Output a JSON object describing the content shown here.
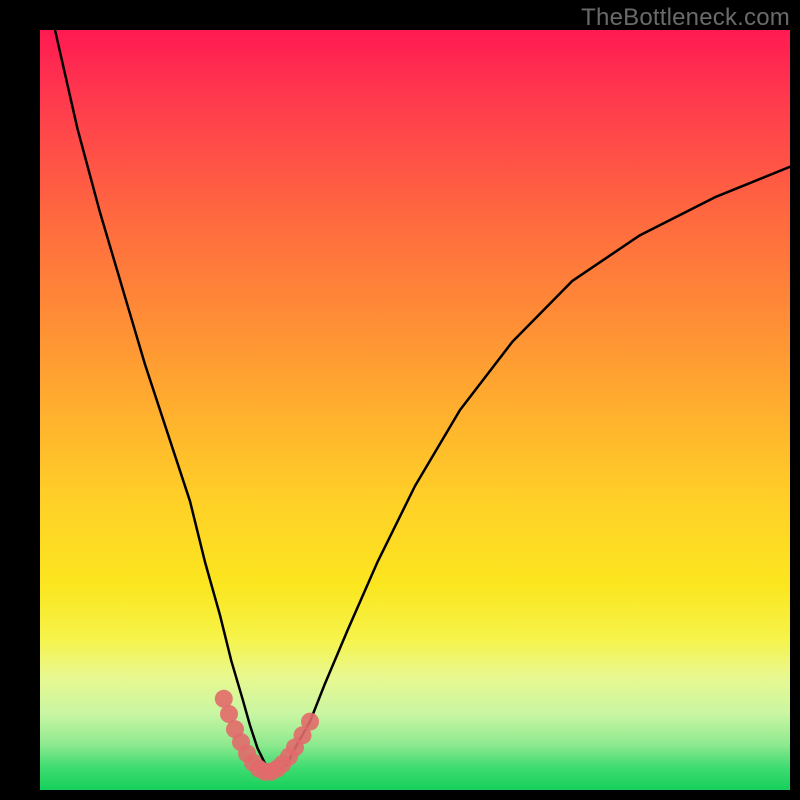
{
  "watermark": "TheBottleneck.com",
  "chart_data": {
    "type": "line",
    "title": "",
    "xlabel": "",
    "ylabel": "",
    "xlim": [
      0,
      100
    ],
    "ylim": [
      0,
      100
    ],
    "series": [
      {
        "name": "bottleneck-curve",
        "x": [
          2,
          5,
          8,
          11,
          14,
          17,
          20,
          22,
          24,
          25.5,
          27,
          28,
          29,
          30,
          31,
          32,
          33,
          34,
          36,
          38,
          41,
          45,
          50,
          56,
          63,
          71,
          80,
          90,
          100
        ],
        "y": [
          100,
          87,
          76,
          66,
          56,
          47,
          38,
          30,
          23,
          17,
          12,
          8.5,
          5.5,
          3.5,
          2.5,
          2.5,
          3.5,
          5.5,
          9,
          14,
          21,
          30,
          40,
          50,
          59,
          67,
          73,
          78,
          82
        ]
      },
      {
        "name": "highlight-band",
        "x": [
          24.5,
          25.2,
          26.0,
          26.8,
          27.6,
          28.4,
          29.2,
          30.0,
          30.8,
          31.6,
          32.3,
          33.2,
          34.0,
          35.0,
          36.0
        ],
        "y": [
          12.0,
          10.0,
          8.0,
          6.3,
          4.8,
          3.6,
          2.8,
          2.4,
          2.4,
          2.8,
          3.4,
          4.4,
          5.6,
          7.2,
          9.0
        ]
      }
    ],
    "gradient_stops": [
      {
        "pos": 0.0,
        "color": "#ff1a52"
      },
      {
        "pos": 0.25,
        "color": "#ff6a3f"
      },
      {
        "pos": 0.5,
        "color": "#ffaf2e"
      },
      {
        "pos": 0.73,
        "color": "#fbe61f"
      },
      {
        "pos": 0.9,
        "color": "#c9f6a3"
      },
      {
        "pos": 1.0,
        "color": "#16cf5a"
      }
    ]
  }
}
